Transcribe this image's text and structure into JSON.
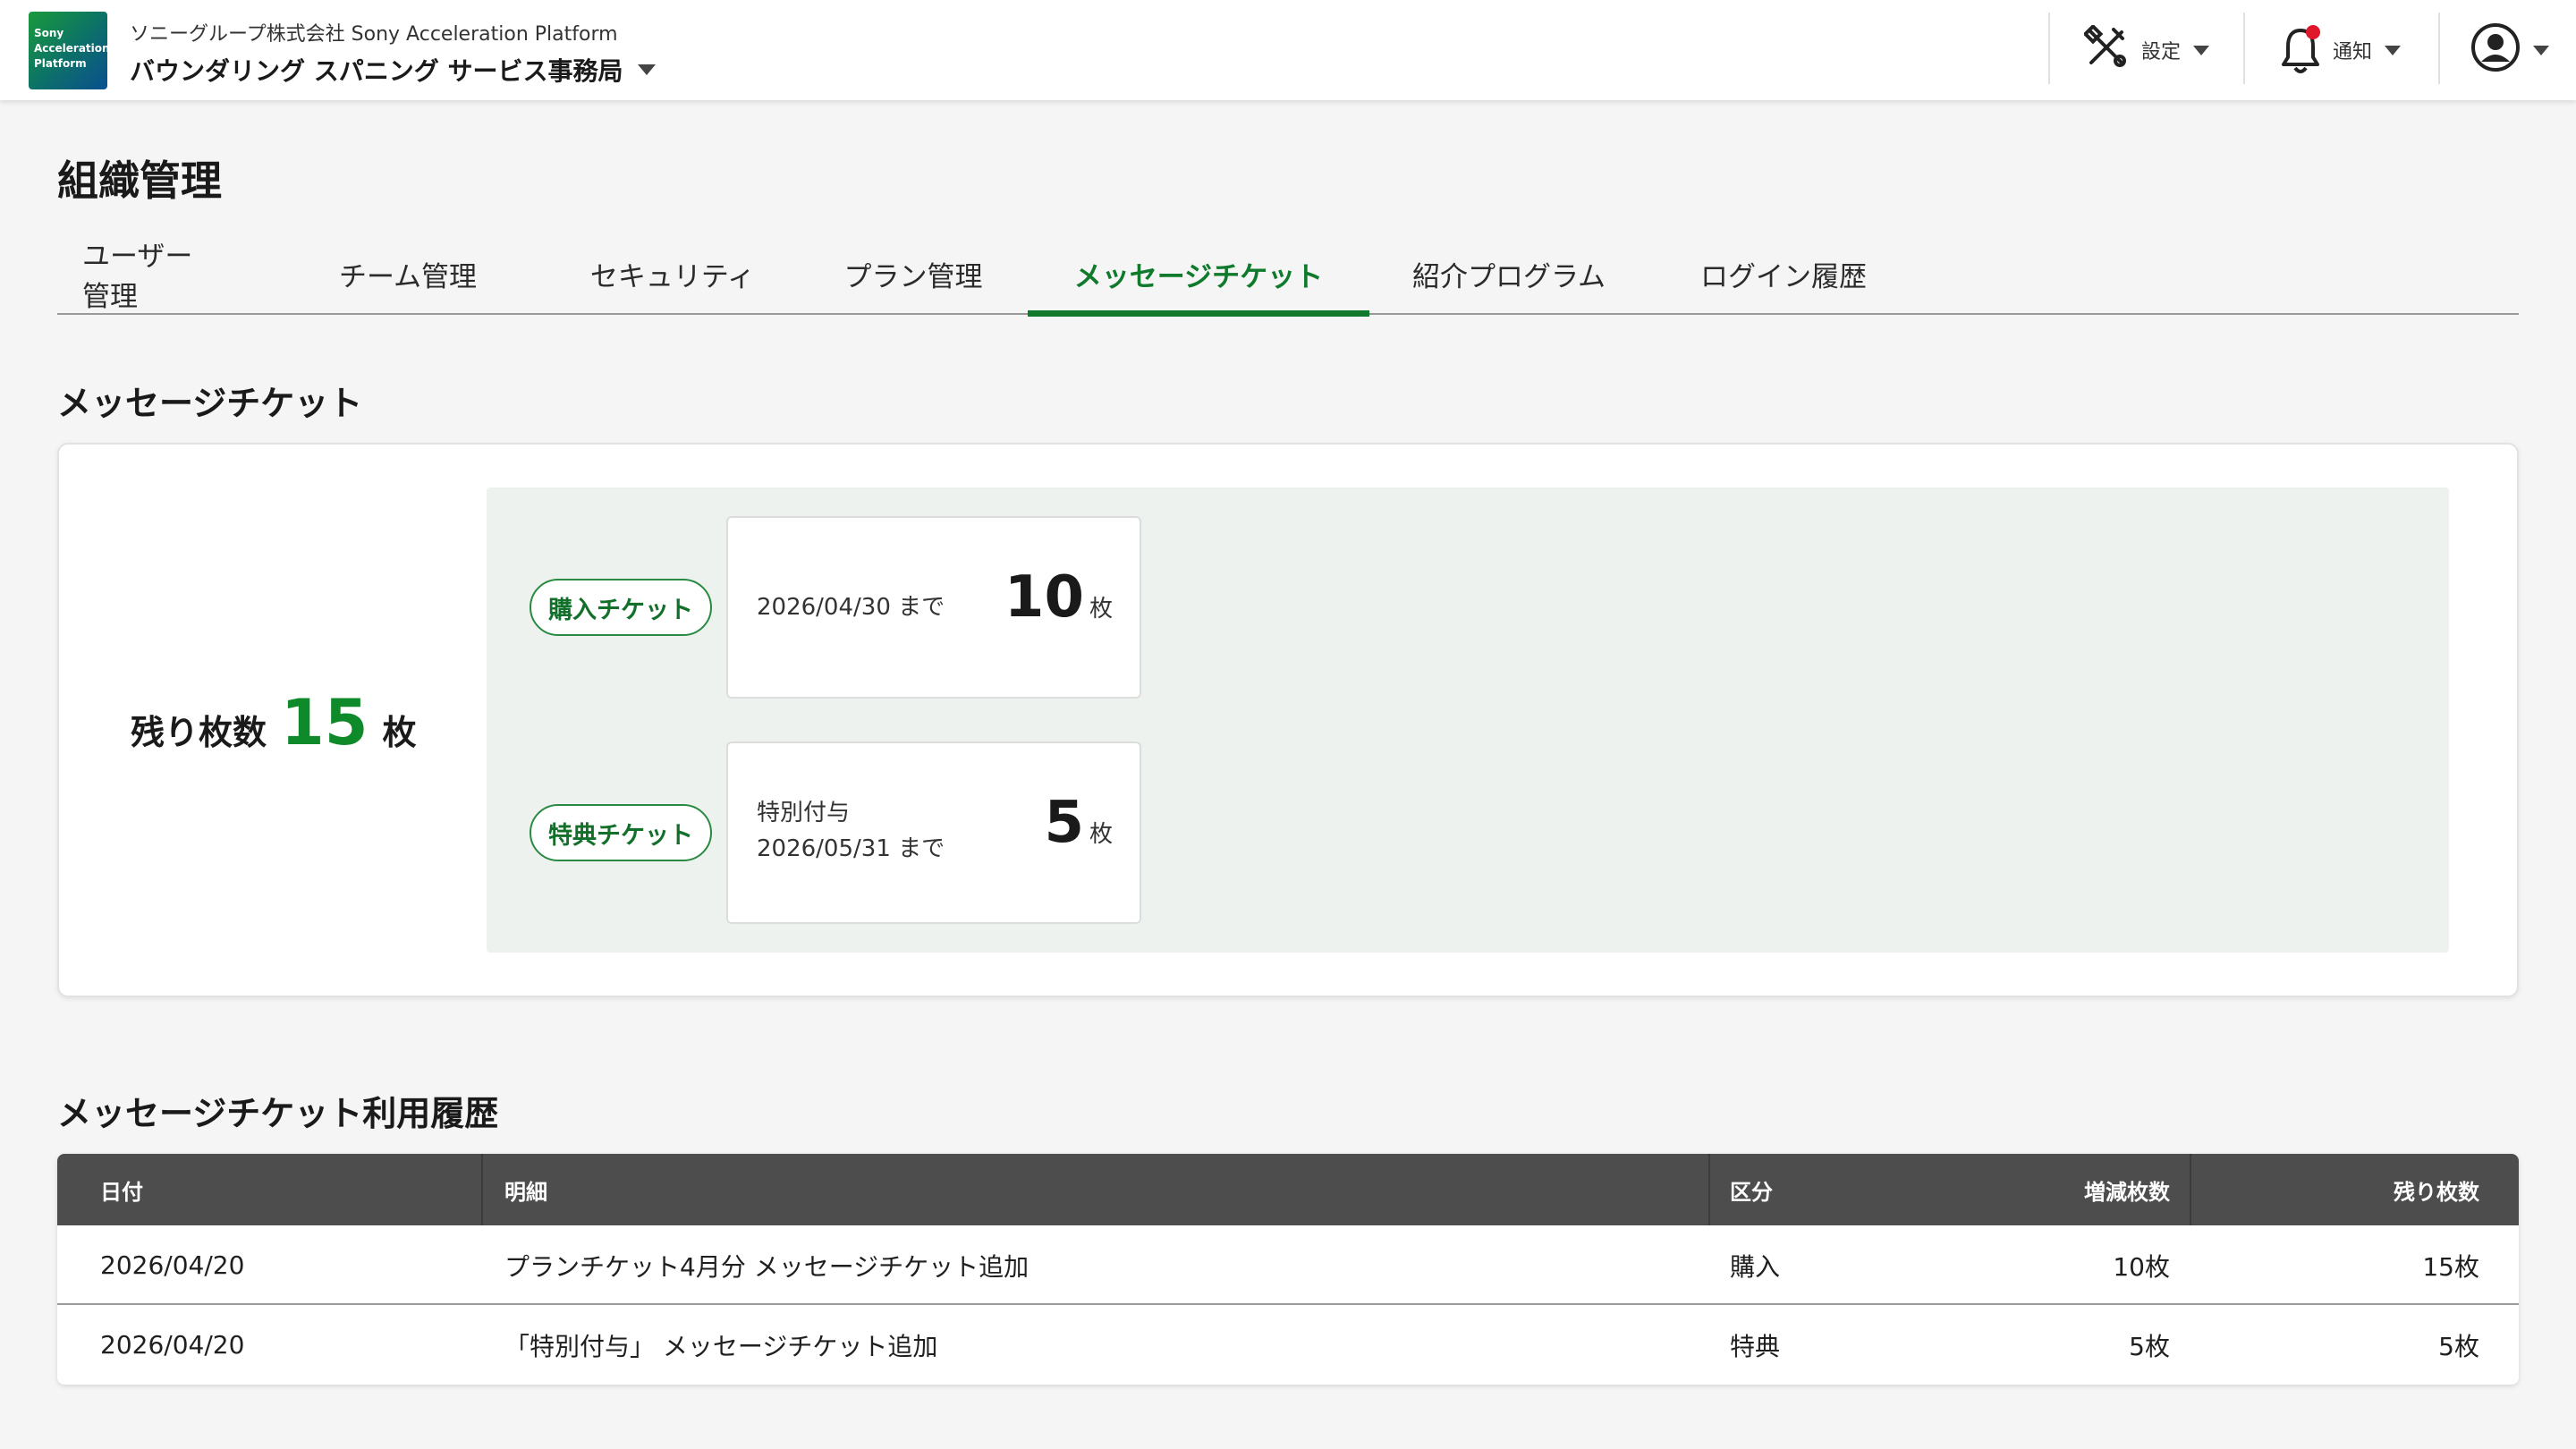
{
  "header": {
    "logo_lines": [
      "Sony",
      "Acceleration",
      "Platform"
    ],
    "company": "ソニーグループ株式会社 Sony Acceleration Platform",
    "org_name": "バウンダリング スパニング サービス事務局",
    "settings_label": "設定",
    "notify_label": "通知",
    "icons": {
      "settings": "tools-icon",
      "notify": "bell-icon",
      "account": "user-avatar-icon"
    },
    "notify_dot_color": "#e0162b"
  },
  "page": {
    "title": "組織管理",
    "tabs": [
      {
        "label": "ユーザー管理",
        "active": false
      },
      {
        "label": "チーム管理",
        "active": false
      },
      {
        "label": "セキュリティ",
        "active": false
      },
      {
        "label": "プラン管理",
        "active": false
      },
      {
        "label": "メッセージチケット",
        "active": true
      },
      {
        "label": "紹介プログラム",
        "active": false
      },
      {
        "label": "ログイン履歴",
        "active": false
      }
    ],
    "accent_color": "#0f7a2b"
  },
  "tickets": {
    "section_title": "メッセージチケット",
    "remaining_label": "残り枚数",
    "remaining_count": "15",
    "remaining_unit": "枚",
    "purchase": {
      "badge": "購入チケット",
      "desc": [
        "2026/04/30 まで"
      ],
      "count": "10",
      "unit": "枚"
    },
    "bonus": {
      "badge": "特典チケット",
      "desc": [
        "特別付与",
        "2026/05/31 まで"
      ],
      "count": "5",
      "unit": "枚"
    }
  },
  "history": {
    "section_title": "メッセージチケット利用履歴",
    "columns": [
      "日付",
      "明細",
      "区分",
      "増減枚数",
      "残り枚数"
    ],
    "rows": [
      [
        "2026/04/20",
        "プランチケット4月分 メッセージチケット追加",
        "購入",
        "10枚",
        "15枚"
      ],
      [
        "2026/04/20",
        "「特別付与」 メッセージチケット追加",
        "特典",
        "5枚",
        "5枚"
      ]
    ]
  }
}
